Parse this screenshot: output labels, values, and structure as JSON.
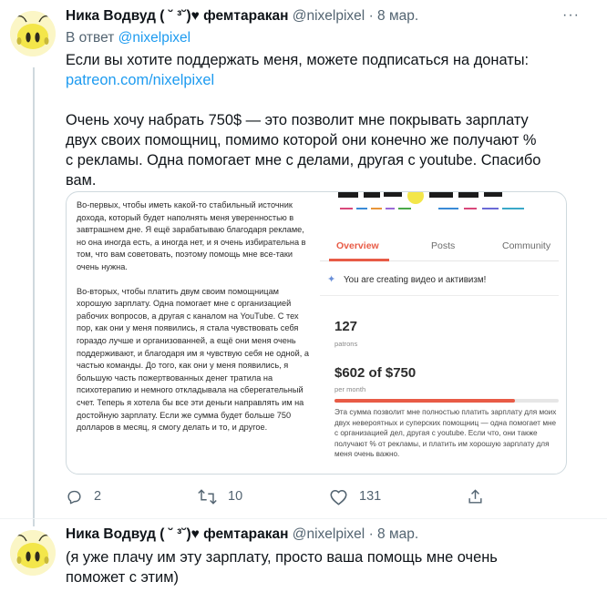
{
  "tweet1": {
    "display_name": "Ника Водвуд ( ˘ ³˘)♥ фемтаракан",
    "handle": "@nixelpixel",
    "dot": "·",
    "date": "8 мар.",
    "more": "···",
    "reply_prefix": "В ответ",
    "reply_handle": "@nixelpixel",
    "para1_line1": "Если вы хотите поддержать меня, можете подписаться на донаты:",
    "para1_link": "patreon.com/nixelpixel",
    "para2_lines": [
      "Очень хочу набрать 750$ — это позволит мне покрывать зарплату",
      "двух своих помощниц, помимо которой они конечно же получают %",
      "с рекламы. Одна помогает мне с делами, другая с youtube. Спасибо",
      "вам."
    ],
    "actions": {
      "reply_count": "2",
      "retweet_count": "10",
      "like_count": "131"
    }
  },
  "media": {
    "left_paragraphs": [
      "Во-первых, чтобы иметь какой-то стабильный источник дохода, который будет наполнять меня уверенностью в завтрашнем дне. Я ещё зарабатываю благодаря рекламе, но она иногда есть, а иногда нет, и я очень избирательна в том, что вам советовать, поэтому помощь мне все-таки очень нужна.",
      "Во-вторых, чтобы платить двум своим помощницам хорошую зарплату. Одна помогает мне с организацией рабочих вопросов, а другая с каналом на YouTube. С тех пор, как они у меня появились, я стала чувствовать себя гораздо лучше и организованней, а ещё они меня очень поддерживают, и благодаря им я чувствую себя не одной, а частью команды. До того, как они у меня появились, я большую часть пожертвованных денег тратила на психотерапию и немного откладывала на сберегательный счет. Теперь я хотела бы все эти деньги направлять им на достойную зарплату. Если же сумма будет больше 750 долларов в месяц, я смогу делать и то, и другое."
    ],
    "tabs": [
      "Overview",
      "Posts",
      "Community"
    ],
    "active_tab": "Overview",
    "creating_text": "You are creating видео и активизм!",
    "patrons_count": "127",
    "patrons_label": "patrons",
    "goal_amount": "$602 of $750",
    "goal_period": "per month",
    "goal_progress": 0.803,
    "goal_description": "Эта сумма позволит мне полностью платить зарплату для моих двух невероятных и суперских помощниц — одна помогает мне с организацией дел, другая с youtube. Если что, они также получают % от рекламы, и платить им хорошую зарплату для меня очень важно.",
    "accent_color": "#e85b46"
  },
  "tweet2": {
    "display_name": "Ника Водвуд ( ˘ ³˘)♥ фемтаракан",
    "handle": "@nixelpixel",
    "dot": "·",
    "date": "8 мар.",
    "text_lines": [
      "(я уже плачу им эту зарплату, просто ваша помощь мне очень",
      "поможет с этим)"
    ]
  },
  "colors": {
    "link": "#1d9bf0",
    "secondary_text": "#536471",
    "avatar_bg": "#fbf6c6"
  }
}
